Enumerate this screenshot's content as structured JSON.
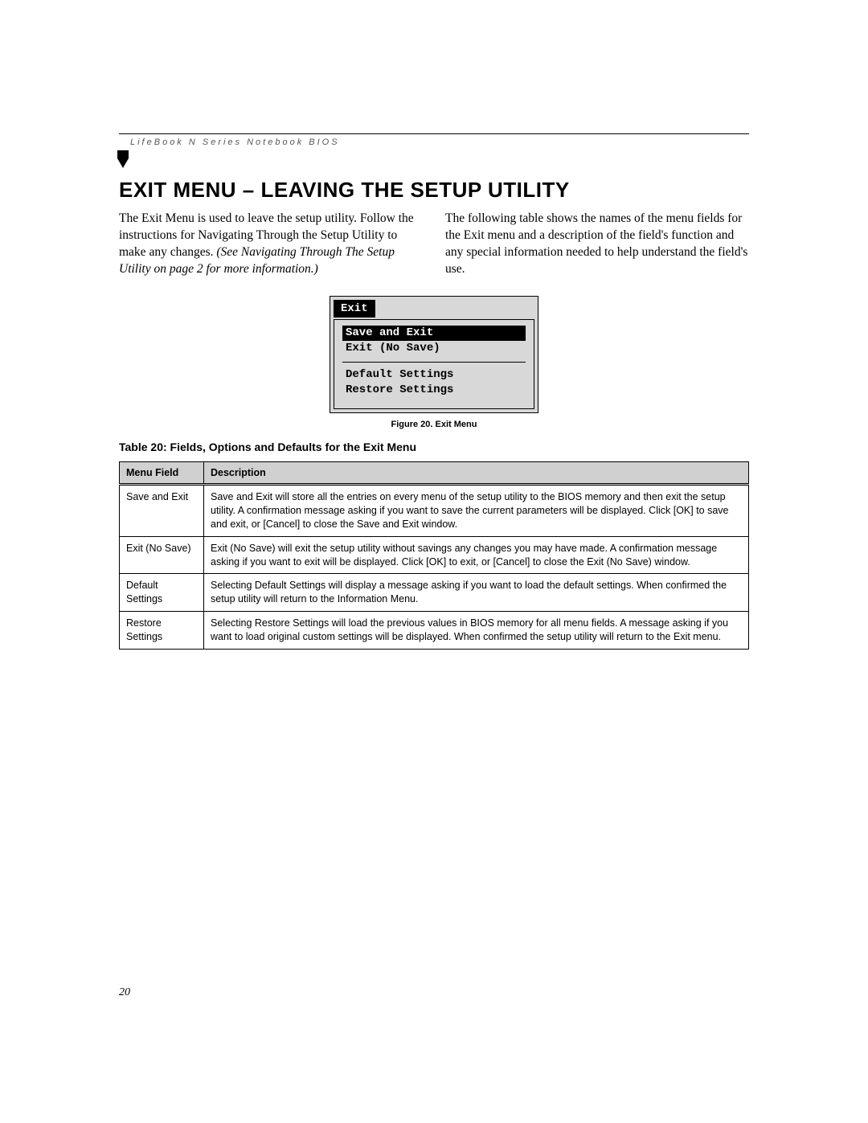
{
  "header": {
    "running_head": "LifeBook N Series Notebook BIOS"
  },
  "section": {
    "title": "EXIT MENU – LEAVING THE SETUP UTILITY",
    "col1_plain": "The Exit Menu is used to leave the setup utility. Follow the instructions for Navigating Through the Setup Utility to make any changes. ",
    "col1_italic": "(See Navigating Through The Setup Utility on page 2 for more information.)",
    "col2": "The following table shows the names of the menu fields for the Exit menu and a description of the field's function and any special information needed to help understand the field's use."
  },
  "bios": {
    "tab": "Exit",
    "items": [
      {
        "label": "Save and Exit",
        "selected": true
      },
      {
        "label": "Exit (No Save)",
        "selected": false
      }
    ],
    "items2": [
      {
        "label": "Default Settings"
      },
      {
        "label": "Restore Settings"
      }
    ],
    "figure_caption": "Figure 20.  Exit Menu"
  },
  "table": {
    "caption": "Table 20: Fields, Options and Defaults for the Exit Menu",
    "head": {
      "c1": "Menu Field",
      "c2": "Description"
    },
    "rows": [
      {
        "field": "Save and Exit",
        "desc": "Save and Exit will store all the entries on every menu of the setup utility to the BIOS memory and then exit the setup utility. A confirmation message asking if you want to save the current parameters will be displayed. Click [OK] to save and exit, or [Cancel] to close the Save and Exit window."
      },
      {
        "field": "Exit (No Save)",
        "desc": "Exit (No Save) will exit the setup utility without savings any changes you may have made. A confirmation message asking if you want to exit will be displayed. Click [OK] to exit, or [Cancel] to close the Exit (No Save) window."
      },
      {
        "field": "Default Settings",
        "desc": "Selecting Default Settings will display a message asking if you want to load the default settings. When confirmed the setup utility will return to the Information Menu."
      },
      {
        "field": "Restore Settings",
        "desc": "Selecting Restore Settings will load the previous values in BIOS memory for all menu fields. A message asking if you want to load original custom settings will be displayed. When confirmed the setup utility will return to the Exit menu."
      }
    ]
  },
  "page_number": "20"
}
